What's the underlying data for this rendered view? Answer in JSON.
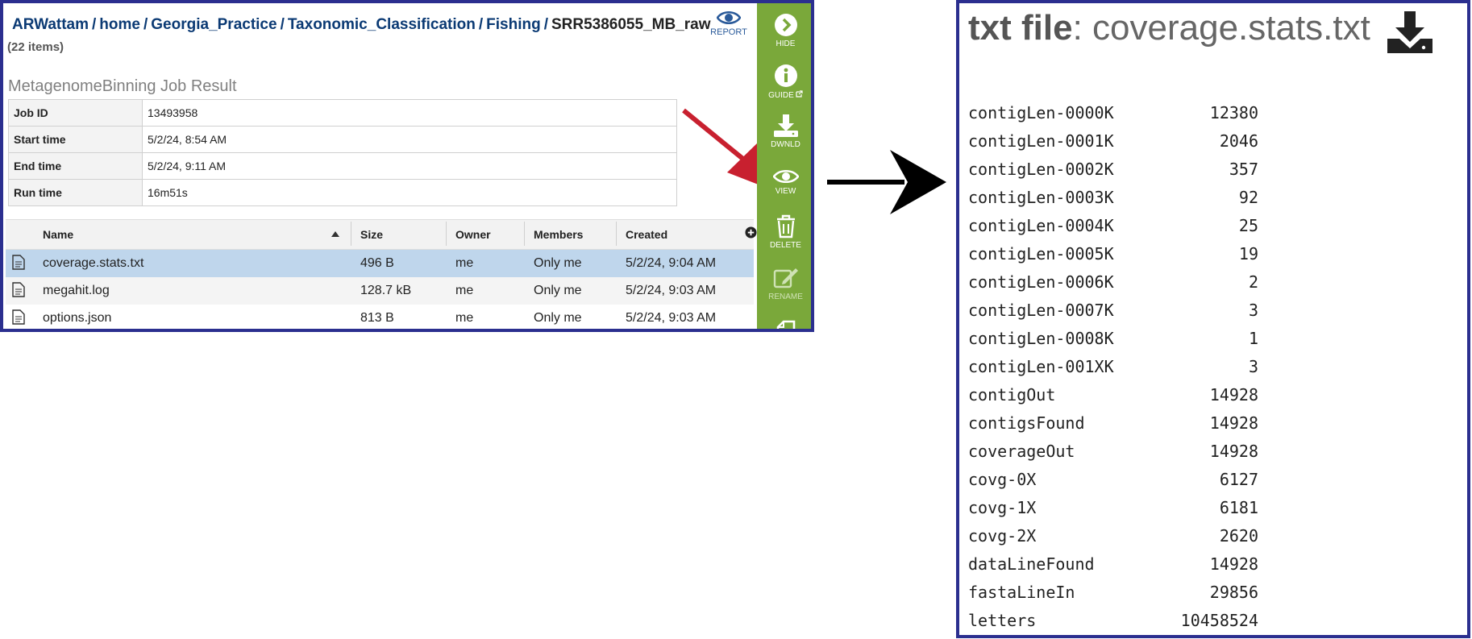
{
  "breadcrumb": {
    "items": [
      "ARWattam",
      "home",
      "Georgia_Practice",
      "Taxonomic_Classification",
      "Fishing"
    ],
    "current": "SRR5386055_MB_raw",
    "item_count": "(22 items)"
  },
  "report_label": "REPORT",
  "job": {
    "title": "MetagenomeBinning Job Result",
    "rows": [
      {
        "key": "Job ID",
        "value": "13493958"
      },
      {
        "key": "Start time",
        "value": "5/2/24, 8:54 AM"
      },
      {
        "key": "End time",
        "value": "5/2/24, 9:11 AM"
      },
      {
        "key": "Run time",
        "value": "16m51s"
      }
    ]
  },
  "grid": {
    "columns": [
      "Name",
      "Size",
      "Owner",
      "Members",
      "Created"
    ],
    "rows": [
      {
        "name": "coverage.stats.txt",
        "size": "496 B",
        "owner": "me",
        "members": "Only me",
        "created": "5/2/24, 9:04 AM",
        "selected": true
      },
      {
        "name": "megahit.log",
        "size": "128.7 kB",
        "owner": "me",
        "members": "Only me",
        "created": "5/2/24, 9:03 AM",
        "selected": false
      },
      {
        "name": "options.json",
        "size": "813 B",
        "owner": "me",
        "members": "Only me",
        "created": "5/2/24, 9:03 AM",
        "selected": false
      }
    ]
  },
  "toolbar": {
    "hide": "HIDE",
    "guide": "GUIDE",
    "download": "DWNLD",
    "view": "VIEW",
    "delete": "DELETE",
    "rename": "RENAME"
  },
  "viewer": {
    "title_prefix": "txt file",
    "title_sep": ": ",
    "filename": "coverage.stats.txt",
    "stats": [
      {
        "key": "contigLen-0000K",
        "value": "12380"
      },
      {
        "key": "contigLen-0001K",
        "value": "2046"
      },
      {
        "key": "contigLen-0002K",
        "value": "357"
      },
      {
        "key": "contigLen-0003K",
        "value": "92"
      },
      {
        "key": "contigLen-0004K",
        "value": "25"
      },
      {
        "key": "contigLen-0005K",
        "value": "19"
      },
      {
        "key": "contigLen-0006K",
        "value": "2"
      },
      {
        "key": "contigLen-0007K",
        "value": "3"
      },
      {
        "key": "contigLen-0008K",
        "value": "1"
      },
      {
        "key": "contigLen-001XK",
        "value": "3"
      },
      {
        "key": "contigOut",
        "value": "14928"
      },
      {
        "key": "contigsFound",
        "value": "14928"
      },
      {
        "key": "coverageOut",
        "value": "14928"
      },
      {
        "key": "covg-0X",
        "value": "6127"
      },
      {
        "key": "covg-1X",
        "value": "6181"
      },
      {
        "key": "covg-2X",
        "value": "2620"
      },
      {
        "key": "dataLineFound",
        "value": "14928"
      },
      {
        "key": "fastaLineIn",
        "value": "29856"
      },
      {
        "key": "letters",
        "value": "10458524"
      }
    ]
  },
  "colors": {
    "toolbar_green": "#7aa83a",
    "panel_border": "#2b2f8f",
    "selected_row": "#bfd6ec",
    "callout_arrow": "#c8202f"
  },
  "icons": [
    "eye-icon",
    "chevron-right-icon",
    "info-icon",
    "download-icon",
    "trash-icon",
    "pencil-icon",
    "copy-icon",
    "file-icon",
    "plus-circle-icon",
    "sort-up-icon"
  ]
}
